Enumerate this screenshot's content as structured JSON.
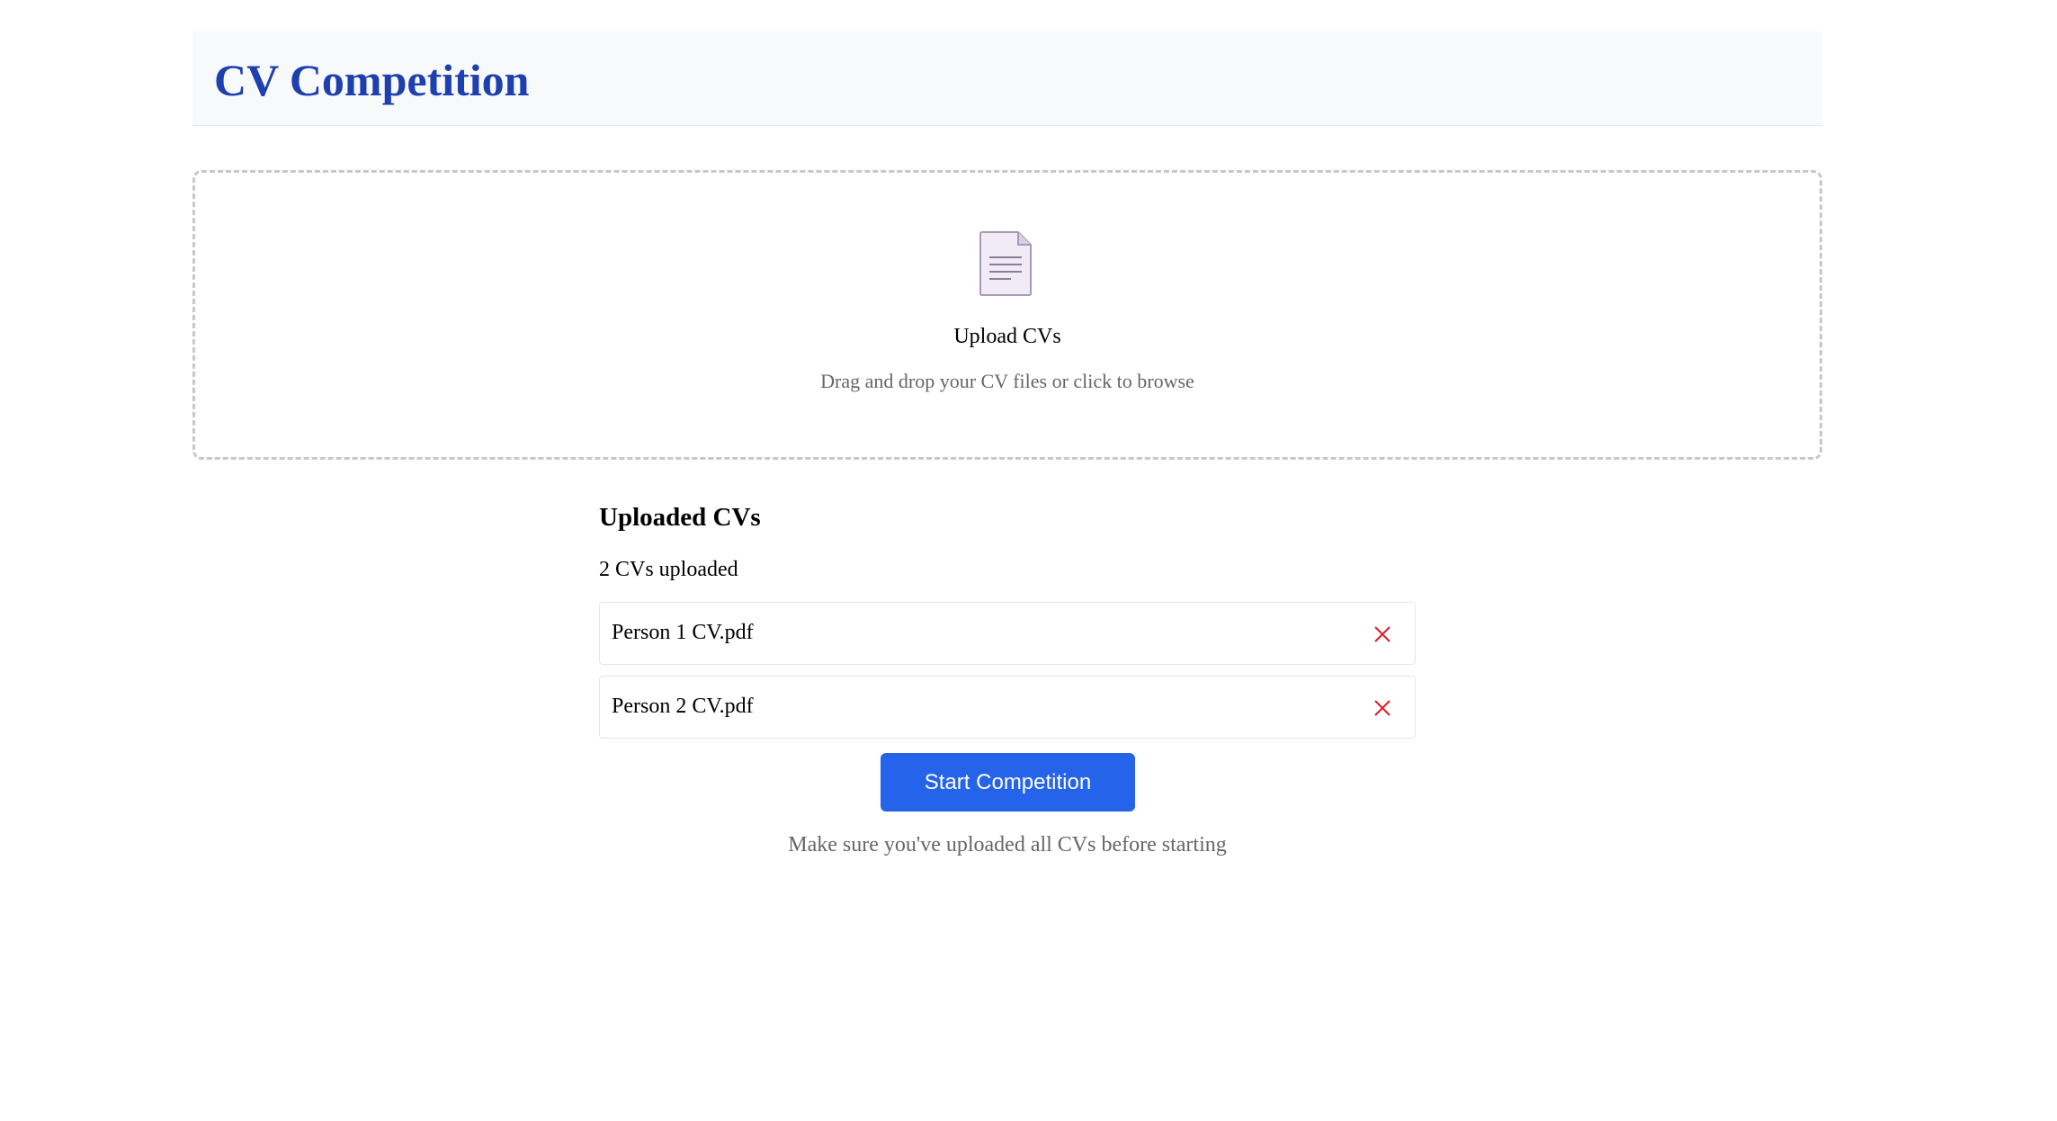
{
  "header": {
    "title": "CV Competition"
  },
  "upload": {
    "icon": "document-icon",
    "title": "Upload CVs",
    "subtitle": "Drag and drop your CV files or click to browse"
  },
  "uploaded": {
    "heading": "Uploaded CVs",
    "count_text": "2 CVs uploaded",
    "files": [
      {
        "name": "Person 1 CV.pdf",
        "remove_icon": "close-icon"
      },
      {
        "name": "Person 2 CV.pdf",
        "remove_icon": "close-icon"
      }
    ]
  },
  "actions": {
    "start_label": "Start Competition",
    "hint": "Make sure you've uploaded all CVs before starting"
  },
  "colors": {
    "title": "#1e40af",
    "primary_button": "#2563eb",
    "remove_icon": "#e11d2a",
    "muted_text": "#666666",
    "header_bg": "#f8f9fb"
  }
}
